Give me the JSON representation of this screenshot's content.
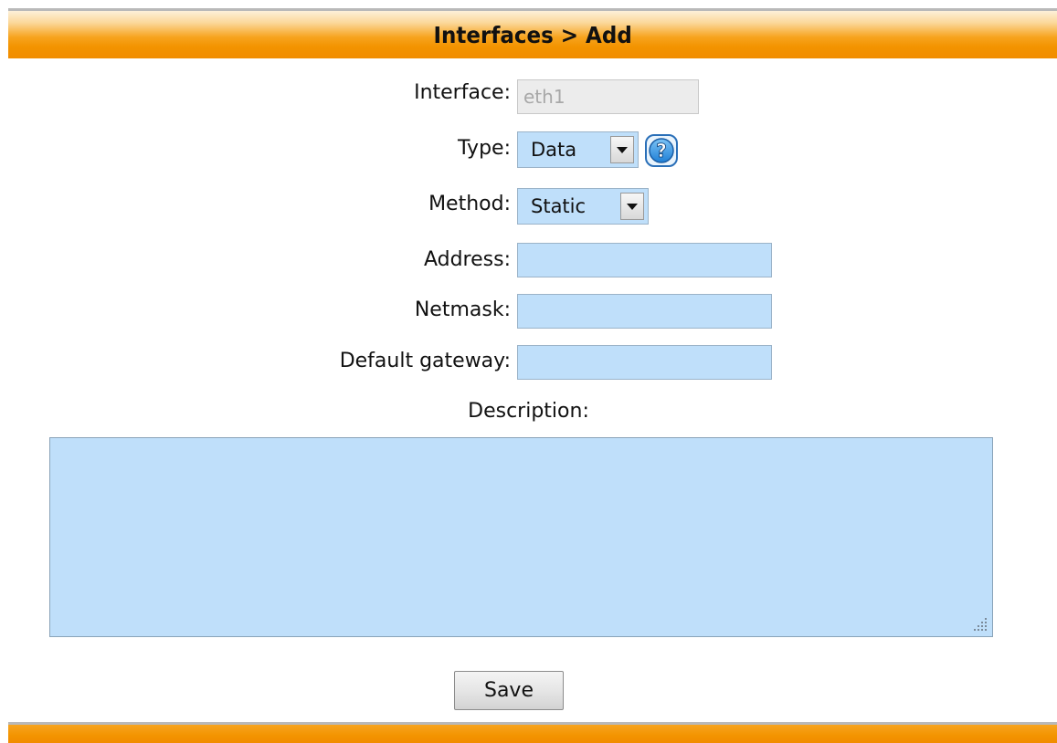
{
  "header": {
    "title": "Interfaces > Add"
  },
  "form": {
    "interface": {
      "label": "Interface:",
      "value": "eth1"
    },
    "type": {
      "label": "Type:",
      "selected": "Data"
    },
    "method": {
      "label": "Method:",
      "selected": "Static"
    },
    "address": {
      "label": "Address:",
      "value": ""
    },
    "netmask": {
      "label": "Netmask:",
      "value": ""
    },
    "gateway": {
      "label": "Default gateway:",
      "value": ""
    },
    "description": {
      "label": "Description:",
      "value": ""
    }
  },
  "actions": {
    "save_label": "Save"
  },
  "colors": {
    "accent_orange": "#f39400",
    "input_blue": "#bfdffa",
    "help_icon_blue": "#2a8de0"
  },
  "icons": {
    "help": "help-question-icon",
    "dropdown": "chevron-down-icon",
    "resize": "resize-grip-icon"
  }
}
